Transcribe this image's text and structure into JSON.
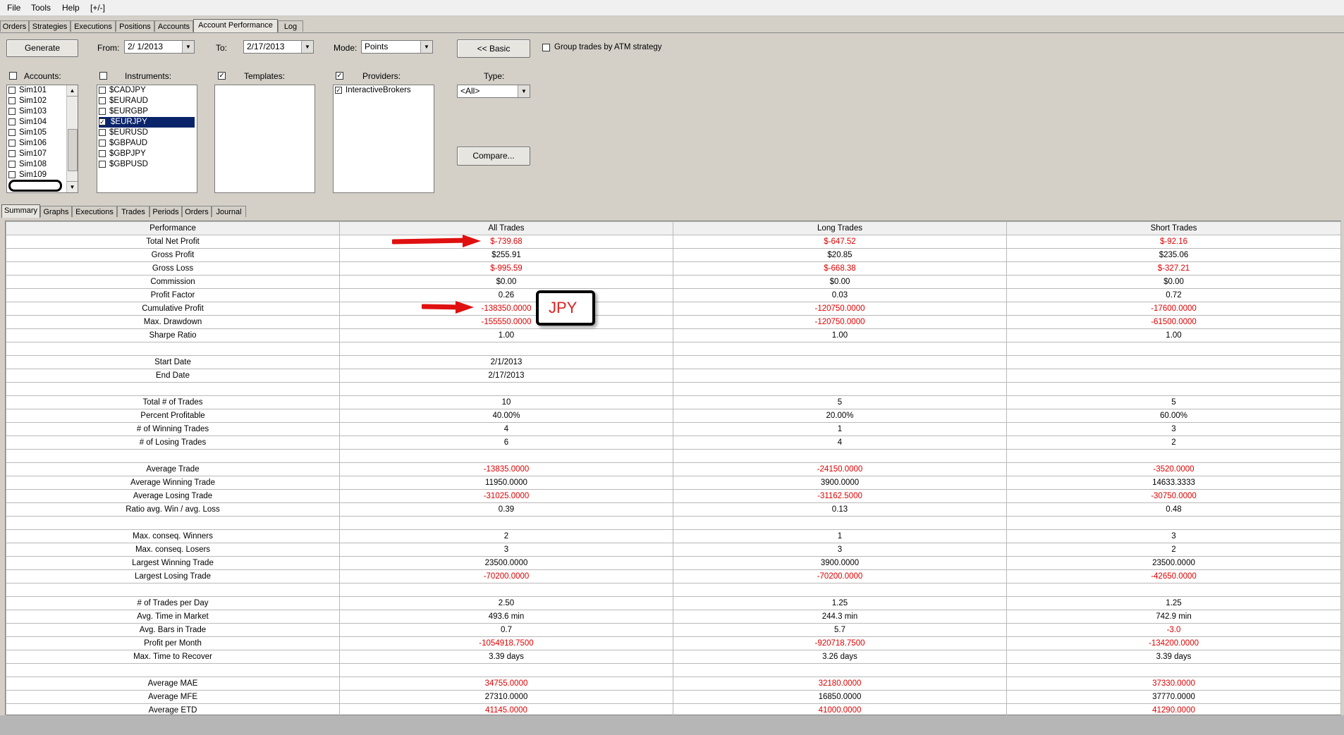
{
  "menu": [
    "File",
    "Tools",
    "Help",
    "[+/-]"
  ],
  "top_tabs": [
    "Orders",
    "Strategies",
    "Executions",
    "Positions",
    "Accounts",
    "Account Performance",
    "Log"
  ],
  "toolbar": {
    "generate": "Generate",
    "from_label": "From:",
    "from_value": "2/  1/2013",
    "to_label": "To:",
    "to_value": "2/17/2013",
    "mode_label": "Mode:",
    "mode_value": "Points",
    "basic_button": "<< Basic",
    "group_label": "Group trades by ATM strategy"
  },
  "filters": {
    "accounts_label": "Accounts:",
    "instruments_label": "Instruments:",
    "templates_label": "Templates:",
    "providers_label": "Providers:",
    "type_label": "Type:",
    "type_value": "<All>",
    "compare_button": "Compare...",
    "accounts": [
      "Sim101",
      "Sim102",
      "Sim103",
      "Sim104",
      "Sim105",
      "Sim106",
      "Sim107",
      "Sim108",
      "Sim109"
    ],
    "instruments": [
      {
        "name": "$CADJPY",
        "checked": false
      },
      {
        "name": "$EURAUD",
        "checked": false
      },
      {
        "name": "$EURGBP",
        "checked": false
      },
      {
        "name": "$EURJPY",
        "checked": true
      },
      {
        "name": "$EURUSD",
        "checked": false
      },
      {
        "name": "$GBPAUD",
        "checked": false
      },
      {
        "name": "$GBPJPY",
        "checked": false
      },
      {
        "name": "$GBPUSD",
        "checked": false
      }
    ],
    "providers": [
      {
        "name": "InteractiveBrokers",
        "checked": true
      }
    ]
  },
  "sub_tabs": [
    "Summary",
    "Graphs",
    "Executions",
    "Trades",
    "Periods",
    "Orders",
    "Journal"
  ],
  "annotation": {
    "jpy": "JPY"
  },
  "table": {
    "headers": [
      "Performance",
      "All Trades",
      "Long Trades",
      "Short Trades"
    ],
    "rows": [
      [
        "Total Net Profit",
        "$-739.68",
        "$-647.52",
        "$-92.16"
      ],
      [
        "Gross Profit",
        "$255.91",
        "$20.85",
        "$235.06"
      ],
      [
        "Gross Loss",
        "$-995.59",
        "$-668.38",
        "$-327.21"
      ],
      [
        "Commission",
        "$0.00",
        "$0.00",
        "$0.00"
      ],
      [
        "Profit Factor",
        "0.26",
        "0.03",
        "0.72"
      ],
      [
        "Cumulative Profit",
        "-138350.0000",
        "-120750.0000",
        "-17600.0000"
      ],
      [
        "Max. Drawdown",
        "-155550.0000",
        "-120750.0000",
        "-61500.0000"
      ],
      [
        "Sharpe Ratio",
        "1.00",
        "1.00",
        "1.00"
      ],
      [
        "",
        "",
        "",
        ""
      ],
      [
        "Start Date",
        "2/1/2013",
        "",
        ""
      ],
      [
        "End Date",
        "2/17/2013",
        "",
        ""
      ],
      [
        "",
        "",
        "",
        ""
      ],
      [
        "Total # of Trades",
        "10",
        "5",
        "5"
      ],
      [
        "Percent Profitable",
        "40.00%",
        "20.00%",
        "60.00%"
      ],
      [
        "# of Winning Trades",
        "4",
        "1",
        "3"
      ],
      [
        "# of Losing Trades",
        "6",
        "4",
        "2"
      ],
      [
        "",
        "",
        "",
        ""
      ],
      [
        "Average Trade",
        "-13835.0000",
        "-24150.0000",
        "-3520.0000"
      ],
      [
        "Average Winning Trade",
        "11950.0000",
        "3900.0000",
        "14633.3333"
      ],
      [
        "Average Losing Trade",
        "-31025.0000",
        "-31162.5000",
        "-30750.0000"
      ],
      [
        "Ratio avg. Win / avg. Loss",
        "0.39",
        "0.13",
        "0.48"
      ],
      [
        "",
        "",
        "",
        ""
      ],
      [
        "Max. conseq. Winners",
        "2",
        "1",
        "3"
      ],
      [
        "Max. conseq. Losers",
        "3",
        "3",
        "2"
      ],
      [
        "Largest Winning Trade",
        "23500.0000",
        "3900.0000",
        "23500.0000"
      ],
      [
        "Largest Losing Trade",
        "-70200.0000",
        "-70200.0000",
        "-42650.0000"
      ],
      [
        "",
        "",
        "",
        ""
      ],
      [
        "# of Trades per Day",
        "2.50",
        "1.25",
        "1.25"
      ],
      [
        "Avg. Time in Market",
        "493.6 min",
        "244.3 min",
        "742.9 min"
      ],
      [
        "Avg. Bars in Trade",
        "0.7",
        "5.7",
        "-3.0"
      ],
      [
        "Profit per Month",
        "-1054918.7500",
        "-920718.7500",
        "-134200.0000"
      ],
      [
        "Max. Time to Recover",
        "3.39 days",
        "3.26 days",
        "3.39 days"
      ],
      [
        "",
        "",
        "",
        ""
      ],
      [
        "Average MAE",
        "34755.0000",
        "32180.0000",
        "37330.0000"
      ],
      [
        "Average MFE",
        "27310.0000",
        "16850.0000",
        "37770.0000"
      ],
      [
        "Average ETD",
        "41145.0000",
        "41000.0000",
        "41290.0000"
      ]
    ],
    "red_cells": [
      [
        0,
        1
      ],
      [
        0,
        2
      ],
      [
        0,
        3
      ],
      [
        2,
        1
      ],
      [
        2,
        2
      ],
      [
        2,
        3
      ],
      [
        5,
        1
      ],
      [
        5,
        2
      ],
      [
        5,
        3
      ],
      [
        6,
        1
      ],
      [
        6,
        2
      ],
      [
        6,
        3
      ],
      [
        17,
        1
      ],
      [
        17,
        2
      ],
      [
        17,
        3
      ],
      [
        19,
        1
      ],
      [
        19,
        2
      ],
      [
        19,
        3
      ],
      [
        25,
        1
      ],
      [
        25,
        2
      ],
      [
        25,
        3
      ],
      [
        29,
        3
      ],
      [
        30,
        1
      ],
      [
        30,
        2
      ],
      [
        30,
        3
      ],
      [
        33,
        1
      ],
      [
        33,
        2
      ],
      [
        33,
        3
      ],
      [
        35,
        1
      ],
      [
        35,
        2
      ],
      [
        35,
        3
      ]
    ]
  },
  "colors": {
    "negative": "#e00000",
    "selection": "#0a246a",
    "annotation_arrow": "#e01010"
  }
}
